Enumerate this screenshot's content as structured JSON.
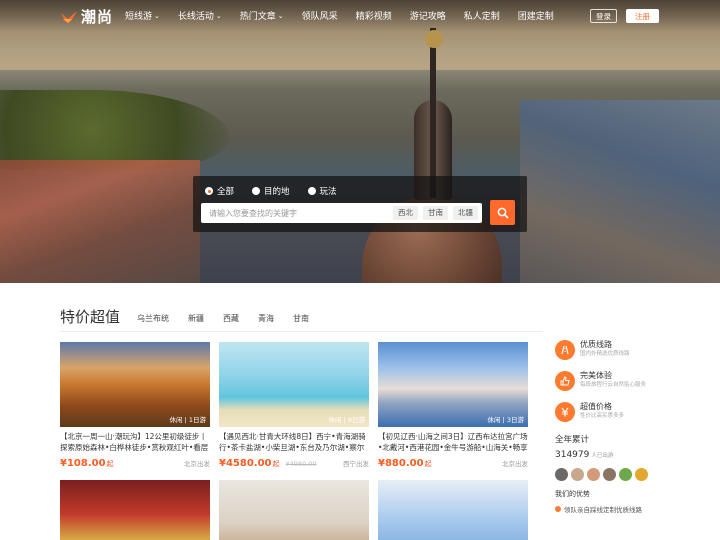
{
  "brand": {
    "name": "潮尚",
    "accent": "#ff6a2c"
  },
  "nav": {
    "items": [
      {
        "label": "短线游",
        "dropdown": true
      },
      {
        "label": "长线活动",
        "dropdown": true
      },
      {
        "label": "热门文章",
        "dropdown": true
      },
      {
        "label": "领队风采",
        "dropdown": false
      },
      {
        "label": "精彩视频",
        "dropdown": false
      },
      {
        "label": "游记攻略",
        "dropdown": false
      },
      {
        "label": "私人定制",
        "dropdown": false
      },
      {
        "label": "团建定制",
        "dropdown": false
      }
    ],
    "login_label": "登录",
    "register_label": "注册"
  },
  "search": {
    "options": [
      {
        "label": "全部",
        "selected": true
      },
      {
        "label": "目的地",
        "selected": false
      },
      {
        "label": "玩法",
        "selected": false
      }
    ],
    "placeholder": "请输入您要查找的关键字",
    "hot_tags": [
      "西北",
      "甘南",
      "北疆"
    ],
    "button_icon": "search-icon"
  },
  "section": {
    "title": "特价超值",
    "tabs": [
      "乌兰布统",
      "新疆",
      "西藏",
      "青海",
      "甘南"
    ]
  },
  "cards": [
    {
      "tag": "休闲 | 1日游",
      "title": "【北京一周一山·潮玩沟】12公里初级徒步丨探索原始森林•白桦林徒步•赏秋观红叶•看层",
      "price": "108.00",
      "unit": "起",
      "old_price": "",
      "origin": "北京出发"
    },
    {
      "tag": "休闲 | 8日游",
      "title": "【遇见西北·甘青大环线8日】西宁•青海湖骑行•茶卡盐湖•小柴旦湖•东台及乃尔湖•察尔",
      "price": "4580.00",
      "unit": "起",
      "old_price": "4980.00",
      "origin": "西宁出发"
    },
    {
      "tag": "休闲 | 3日游",
      "title": "【初见辽西·山海之间3日】辽西布达拉宫广场•北戴河•西港花园•金牛号游船•山海关•畅享",
      "price": "880.00",
      "unit": "起",
      "old_price": "",
      "origin": "北京出发"
    },
    {
      "tag": "",
      "title": "",
      "price": "",
      "unit": "",
      "old_price": "",
      "origin": ""
    },
    {
      "tag": "",
      "title": "",
      "price": "",
      "unit": "",
      "old_price": "",
      "origin": ""
    },
    {
      "tag": "",
      "title": "",
      "price": "",
      "unit": "",
      "old_price": "",
      "origin": ""
    }
  ],
  "sidebar": {
    "features": [
      {
        "title": "优质线路",
        "sub": "国内外精选优质线路",
        "icon": "road-icon"
      },
      {
        "title": "完美体验",
        "sub": "每段旅程行云自然贴心服务",
        "icon": "thumb-icon"
      },
      {
        "title": "超值价格",
        "sub": "性价比高实惠多多",
        "icon": "price-icon"
      }
    ],
    "total_label": "全年累计",
    "total_count": "314979",
    "total_unit": "人已出游",
    "advantages_title": "我们的优势",
    "advantages": [
      "领队亲自踩线定制优质线路"
    ]
  }
}
